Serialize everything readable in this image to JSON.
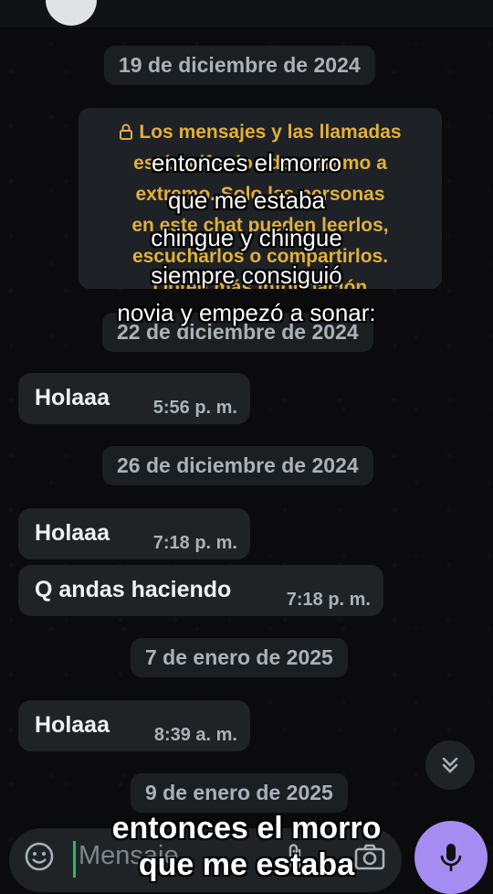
{
  "dates": [
    "19 de diciembre de 2024",
    "22 de diciembre de 2024",
    "26 de diciembre de 2024",
    "7 de enero de 2025",
    "9 de enero de 2025"
  ],
  "e2e_notice": {
    "lines": [
      "Los mensajes y las llamadas",
      "están cifrados de extremo a",
      "extremo. Solo las personas",
      "en este chat pueden leerlos,",
      "escucharlos o compartirlos.",
      "Obtén más información"
    ],
    "color": "#e0b03c"
  },
  "messages": [
    {
      "text": "Holaaa",
      "time": "5:56 p. m."
    },
    {
      "text": "Holaaa",
      "time": "7:18 p. m."
    },
    {
      "text": "Q andas haciendo",
      "time": "7:18 p. m."
    },
    {
      "text": "Holaaa",
      "time": "8:39 a. m."
    }
  ],
  "input": {
    "placeholder": "Mensaje"
  },
  "overlay_caption": {
    "lines": [
      "entonces el morro",
      "que me estaba",
      "chingue y chingue",
      "siempre consiguió",
      "novia y empezó a sonar:"
    ]
  },
  "overlay_bottom": {
    "lines": [
      "entonces el morro",
      "que me estaba"
    ]
  },
  "icons": {
    "scroll_down": "chevron-double-down-icon",
    "mic": "mic-icon",
    "emoji": "sticker-icon",
    "attach": "paperclip-icon",
    "camera": "camera-icon",
    "lock": "lock-icon"
  },
  "colors": {
    "accent": "#21c063",
    "mic_button": "#a58cf0",
    "bubble": "#202326"
  }
}
